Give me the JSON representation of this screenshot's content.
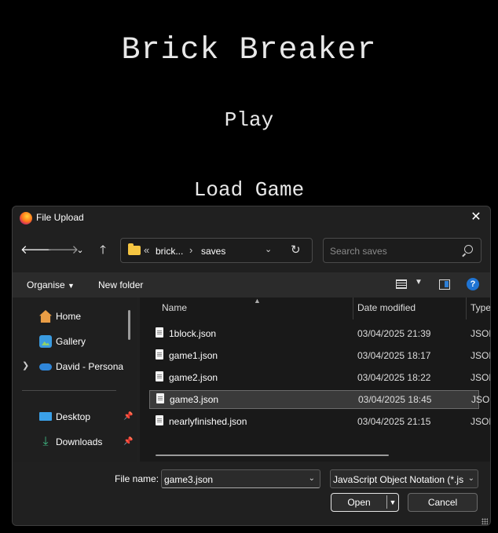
{
  "game": {
    "title": "Brick Breaker",
    "menu": {
      "play": "Play",
      "load": "Load Game"
    }
  },
  "dialog": {
    "title": "File Upload",
    "nav": {
      "back_icon": "arrow-left",
      "forward_icon": "arrow-right",
      "recent_icon": "chevron-down",
      "up_icon": "arrow-up",
      "breadcrumb_overflow": "«",
      "breadcrumbs": [
        "brick...",
        "saves"
      ],
      "breadcrumb_sep": "›",
      "search_placeholder": "Search saves"
    },
    "commands": {
      "organise": "Organise",
      "new_folder": "New folder"
    },
    "sidebar": {
      "items": [
        {
          "label": "Home",
          "icon": "home-icon"
        },
        {
          "label": "Gallery",
          "icon": "gallery-icon"
        },
        {
          "label": "David - Persona",
          "icon": "cloud-icon"
        },
        {
          "label": "Desktop",
          "icon": "desktop-icon",
          "pinned": true
        },
        {
          "label": "Downloads",
          "icon": "download-icon",
          "pinned": true
        }
      ]
    },
    "columns": {
      "name": "Name",
      "date": "Date modified",
      "type": "Type"
    },
    "files": [
      {
        "name": "1block.json",
        "date": "03/04/2025 21:39",
        "type": "JSON"
      },
      {
        "name": "game1.json",
        "date": "03/04/2025 18:17",
        "type": "JSON"
      },
      {
        "name": "game2.json",
        "date": "03/04/2025 18:22",
        "type": "JSON"
      },
      {
        "name": "game3.json",
        "date": "03/04/2025 18:45",
        "type": "JSON",
        "selected": true
      },
      {
        "name": "nearlyfinished.json",
        "date": "03/04/2025 21:15",
        "type": "JSON"
      }
    ],
    "footer": {
      "file_name_label": "File name:",
      "file_name_value": "game3.json",
      "file_type": "JavaScript Object Notation (*.js",
      "open": "Open",
      "cancel": "Cancel"
    }
  },
  "colors": {
    "accent": "#1f74d3",
    "folder": "#f5c542",
    "background": "#000000",
    "dialog": "#202020"
  }
}
